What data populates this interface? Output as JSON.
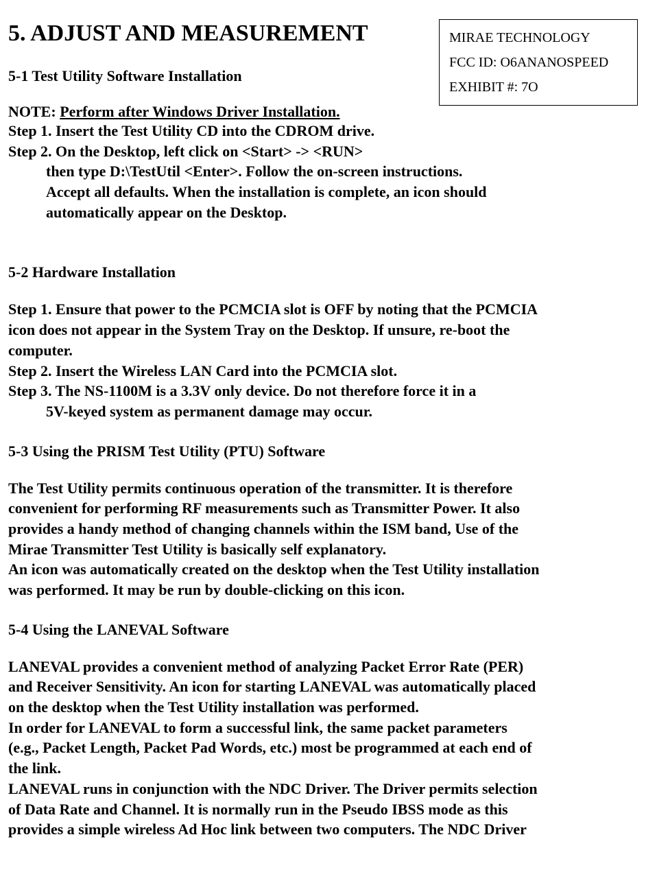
{
  "header_box": {
    "line1": "MIRAE TECHNOLOGY",
    "line2": "FCC ID:  O6ANANOSPEED",
    "line3": "EXHIBIT #: 7O"
  },
  "title": "5.  ADJUST AND MEASUREMENT",
  "section_5_1": {
    "heading": "5-1 Test Utility Software Installation",
    "note_prefix": "NOTE: ",
    "note_underlined": "Perform after Windows Driver Installation.",
    "step1": "Step 1. Insert the Test Utility CD into the CDROM drive.",
    "step2": "Step 2. On the Desktop, left click on <Start> -> <RUN>",
    "step2_cont1": "then type D:\\TestUtil <Enter>. Follow the on-screen instructions.",
    "step2_cont2": "Accept all defaults. When the installation is complete, an icon should",
    "step2_cont3": "automatically appear on the Desktop."
  },
  "section_5_2": {
    "heading": "5-2 Hardware Installation",
    "step1_l1": "Step 1. Ensure that power to the PCMCIA slot is OFF by noting that the PCMCIA",
    "step1_l2": "icon does not appear in the System Tray on the Desktop.  If unsure, re-boot the",
    "step1_l3": "computer.",
    "step2": "Step 2. Insert the Wireless LAN Card into the PCMCIA slot.",
    "step3_l1": "Step 3. The NS-1100M is a 3.3V only device.  Do not therefore force it in a",
    "step3_l2": "5V-keyed system as permanent damage may occur."
  },
  "section_5_3": {
    "heading": "5-3 Using the PRISM Test Utility (PTU) Software",
    "p1_l1": "The Test Utility permits continuous operation of the transmitter. It is therefore",
    "p1_l2": "convenient for performing RF measurements such as Transmitter Power. It also",
    "p1_l3": "provides a handy method of changing channels within the ISM band, Use of the",
    "p1_l4": "Mirae Transmitter Test Utility is basically self explanatory.",
    "p2_l1": "An icon was automatically created on the desktop when the Test Utility installation",
    "p2_l2": "was performed. It may be run by double-clicking on this icon."
  },
  "section_5_4": {
    "heading": "5-4 Using the LANEVAL Software",
    "p1_l1": "LANEVAL provides a convenient method of analyzing Packet Error Rate (PER)",
    "p1_l2": "and Receiver Sensitivity. An icon for starting LANEVAL was automatically placed",
    "p1_l3": "on the desktop when the Test Utility installation was performed.",
    "p2_l1": "In order for LANEVAL to form a successful link, the same packet parameters",
    "p2_l2": "(e.g., Packet Length, Packet Pad Words, etc.)  most be programmed at each end of",
    "p2_l3": "the link.",
    "p3_l1": "LANEVAL runs in conjunction with the NDC Driver. The Driver permits selection",
    "p3_l2": "of Data Rate and Channel. It is normally run in the Pseudo IBSS mode as this",
    "p3_l3": "provides a simple wireless Ad Hoc link between two computers. The NDC Driver"
  }
}
